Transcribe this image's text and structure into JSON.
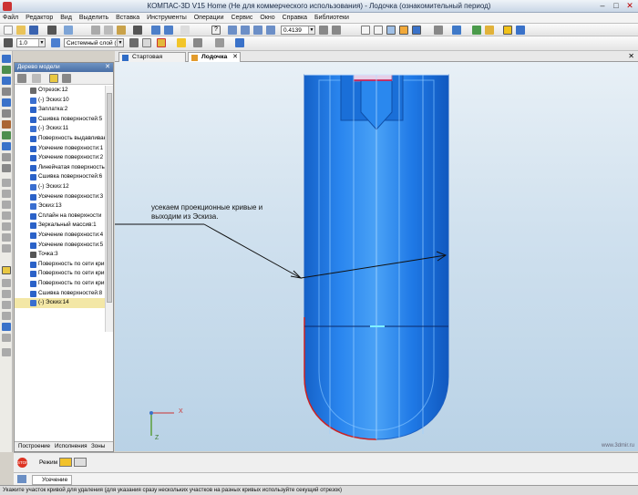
{
  "window": {
    "title": "КОМПАС-3D V15 Home (Не для коммерческого использования) - Лодочка (ознакомительный период)"
  },
  "menu": [
    "Файл",
    "Редактор",
    "Вид",
    "Выделить",
    "Вставка",
    "Инструменты",
    "Операции",
    "Сервис",
    "Окно",
    "Справка",
    "Библиотеки"
  ],
  "toolbar": {
    "line_width": "1.0",
    "layer": "Системный слой (0)",
    "zoom": "0.4139"
  },
  "tree": {
    "title": "Дерево модели",
    "items": [
      {
        "label": "Отрезок:12",
        "color": "#6a6a6a"
      },
      {
        "label": "(-) Эскиз:10",
        "color": "#3a6fd0"
      },
      {
        "label": "Заплатка:2",
        "color": "#2b62c8"
      },
      {
        "label": "Сшивка поверхностей:5",
        "color": "#2b62c8"
      },
      {
        "label": "(-) Эскиз:11",
        "color": "#3a6fd0"
      },
      {
        "label": "Поверхность выдавливания",
        "color": "#2b62c8"
      },
      {
        "label": "Усечение поверхности:1",
        "color": "#2b62c8"
      },
      {
        "label": "Усечение поверхности:2",
        "color": "#2b62c8"
      },
      {
        "label": "Линейчатая поверхность",
        "color": "#2b62c8"
      },
      {
        "label": "Сшивка поверхностей:6",
        "color": "#2b62c8"
      },
      {
        "label": "(-) Эскиз:12",
        "color": "#3a6fd0"
      },
      {
        "label": "Усечение поверхности:3",
        "color": "#2b62c8"
      },
      {
        "label": "Эскиз:13",
        "color": "#3a6fd0"
      },
      {
        "label": "Сплайн на поверхности",
        "color": "#2b62c8"
      },
      {
        "label": "Зеркальный массив:1",
        "color": "#2b62c8"
      },
      {
        "label": "Усечение поверхности:4",
        "color": "#2b62c8"
      },
      {
        "label": "Усечение поверхности:5",
        "color": "#2b62c8"
      },
      {
        "label": "Точка:3",
        "color": "#555555"
      },
      {
        "label": "Поверхность по сети кривых",
        "color": "#2b62c8"
      },
      {
        "label": "Поверхность по сети кривых",
        "color": "#2b62c8"
      },
      {
        "label": "Поверхность по сети кривых",
        "color": "#2b62c8"
      },
      {
        "label": "Сшивка поверхностей:8",
        "color": "#2b62c8"
      },
      {
        "label": "(-) Эскиз:14",
        "color": "#3a6fd0"
      }
    ],
    "tabs": [
      "Построение",
      "Исполнения",
      "Зоны"
    ]
  },
  "doc_tabs": [
    {
      "label": "Стартовая страница"
    },
    {
      "label": "Лодочка"
    }
  ],
  "annotation": "усекаем проекционные кривые и выходим из Эскиза.",
  "triad": {
    "x": "X",
    "z": "Z"
  },
  "watermark": "www.3dmir.ru",
  "bottom": {
    "mode_label": "Режим",
    "command": "Усечение"
  },
  "status": "Укажите участок кривой для удаления (для указания сразу нескольких участков на разных кривых используйте секущий отрезок)",
  "colors": {
    "model": "#1e7ef0",
    "selection": "#cc2222",
    "accent": "#3a6fd0"
  }
}
